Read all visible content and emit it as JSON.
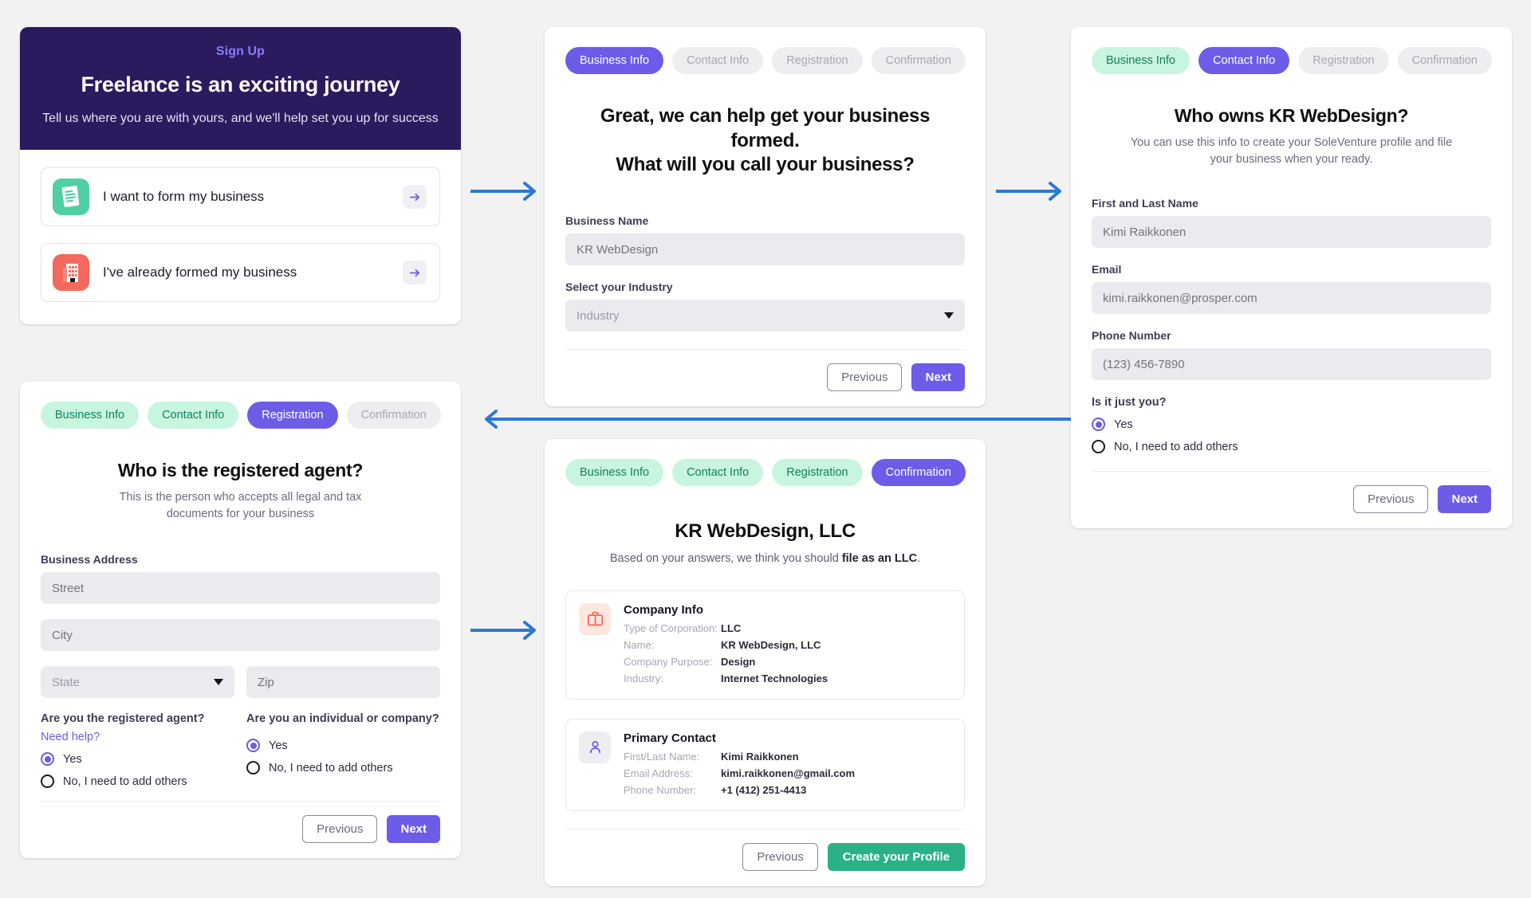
{
  "signup": {
    "eyebrow": "Sign Up",
    "title": "Freelance is an exciting journey",
    "subtitle": "Tell us where you are with yours, and we'll help set you up for success",
    "choices": [
      {
        "label": "I want to form my business",
        "icon": "document-icon"
      },
      {
        "label": "I've already formed my business",
        "icon": "building-icon"
      }
    ]
  },
  "steps": {
    "business_info": "Business Info",
    "contact_info": "Contact Info",
    "registration": "Registration",
    "confirmation": "Confirmation"
  },
  "buttons": {
    "previous": "Previous",
    "next": "Next",
    "create_profile": "Create your Profile"
  },
  "business_step": {
    "title_line1": "Great, we can help get your business formed.",
    "title_line2": "What will you call your business?",
    "business_name_label": "Business Name",
    "business_name_placeholder": "KR WebDesign",
    "industry_label": "Select your Industry",
    "industry_placeholder": "Industry"
  },
  "contact_step": {
    "title": "Who owns KR WebDesign?",
    "subtitle": "You can use this info to create your SoleVenture profile and file your business when your ready.",
    "name_label": "First and Last Name",
    "name_placeholder": "Kimi Raikkonen",
    "email_label": "Email",
    "email_placeholder": "kimi.raikkonen@prosper.com",
    "phone_label": "Phone Number",
    "phone_placeholder": "(123) 456-7890",
    "radio_question": "Is it just you?",
    "radio_yes": "Yes",
    "radio_no": "No, I need to add others"
  },
  "registration_step": {
    "title": "Who is the registered agent?",
    "subtitle": "This is the person who accepts all legal and tax documents for your business",
    "address_label": "Business Address",
    "street_placeholder": "Street",
    "city_placeholder": "City",
    "state_placeholder": "State",
    "zip_placeholder": "Zip",
    "agent_question": "Are you the registered agent?",
    "need_help": "Need help?",
    "agent_yes": "Yes",
    "agent_no": "No, I need to add others",
    "entity_question": "Are you an individual or company?",
    "entity_yes": "Yes",
    "entity_no": "No, I need to add others"
  },
  "confirmation_step": {
    "title": "KR WebDesign, LLC",
    "note_prefix": "Based on your answers, we think you should ",
    "note_strong": "file as an LLC",
    "note_suffix": ".",
    "company": {
      "heading": "Company Info",
      "icon": "briefcase-icon",
      "rows": [
        {
          "key": "Type of Corporation:",
          "value": "LLC"
        },
        {
          "key": "Name:",
          "value": "KR WebDesign, LLC"
        },
        {
          "key": "Company Purpose:",
          "value": "Design"
        },
        {
          "key": "Industry:",
          "value": "Internet Technologies"
        }
      ]
    },
    "contact": {
      "heading": "Primary Contact",
      "icon": "person-icon",
      "rows": [
        {
          "key": "First/Last Name:",
          "value": "Kimi Raikkonen"
        },
        {
          "key": "Email Address:",
          "value": "kimi.raikkonen@gmail.com"
        },
        {
          "key": "Phone Number:",
          "value": "+1 (412) 251-4413"
        }
      ]
    }
  },
  "colors": {
    "brand_purple": "#6c5ce7",
    "hero_navy": "#2b1a5e",
    "step_done_bg": "#c8f5df",
    "step_done_text": "#12805c",
    "success_green": "#2bb187",
    "connector_blue": "#2a7ad4",
    "icon_green": "#4fcfa3",
    "icon_red": "#f4685e"
  }
}
